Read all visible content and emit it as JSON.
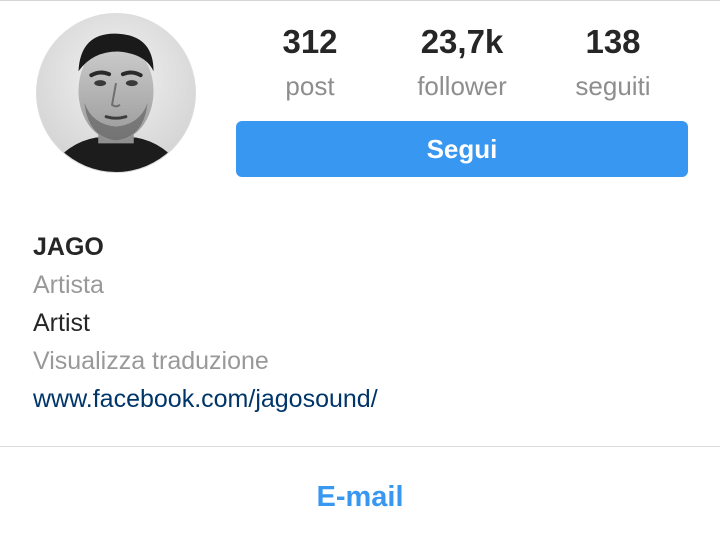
{
  "profile": {
    "avatar_alt": "profile-photo",
    "stats": [
      {
        "value": "312",
        "label": "post"
      },
      {
        "value": "23,7k",
        "label": "follower"
      },
      {
        "value": "138",
        "label": "seguiti"
      }
    ],
    "follow_label": "Segui",
    "name": "JAGO",
    "category": "Artista",
    "bio_text": "Artist",
    "translate_label": "Visualizza traduzione",
    "website": "www.facebook.com/jagosound/",
    "email_label": "E-mail"
  },
  "colors": {
    "accent": "#3897f0",
    "link": "#003569",
    "muted": "#999999",
    "text": "#262626"
  }
}
